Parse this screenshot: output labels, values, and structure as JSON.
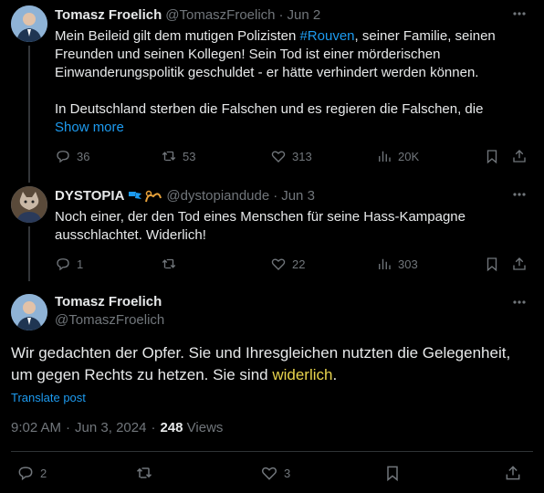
{
  "tweet1": {
    "author_name": "Tomasz Froelich",
    "handle": "@TomaszFroelich",
    "separator": "·",
    "date": "Jun 2",
    "text_part1": "Mein Beileid gilt dem mutigen Polizisten ",
    "hashtag": "#Rouven",
    "text_part2": ", seiner Familie, seinen",
    "text_line2": "Freunden und seinen Kollegen! Sein Tod ist einer mörderischen",
    "text_line3": "Einwanderungspolitik geschuldet - er hätte verhindert werden können.",
    "text_line4": "In Deutschland sterben die Falschen und es regieren die Falschen, die",
    "show_more": "Show more",
    "replies": "36",
    "reposts": "53",
    "likes": "313",
    "views": "20K"
  },
  "tweet2": {
    "author_name": "DYSTOPIA",
    "handle": "@dystopiandude",
    "separator": "·",
    "date": "Jun 3",
    "text_line1": "Noch einer, der den Tod eines Menschen für seine Hass-Kampagne",
    "text_line2": "ausschlachtet. Widerlich!",
    "replies": "1",
    "reposts": "",
    "likes": "22",
    "views": "303"
  },
  "main_tweet": {
    "author_name": "Tomasz Froelich",
    "handle": "@TomaszFroelich",
    "text_line1": "Wir gedachten der Opfer. Sie und Ihresgleichen nutzten die Gelegenheit,",
    "text_line2_pre": "um gegen Rechts zu hetzen. Sie sind ",
    "text_highlight": "widerlich",
    "text_line2_post": ".",
    "translate": "Translate post",
    "time": "9:02 AM",
    "separator": "·",
    "date": "Jun 3, 2024",
    "separator2": "·",
    "views_count": "248",
    "views_label": "Views",
    "replies": "2",
    "reposts": "",
    "likes": "3"
  },
  "colors": {
    "accent": "#1d9bf0",
    "highlight": "#e8d44d",
    "muted": "#71767b"
  },
  "icons": [
    "more-icon",
    "reply-icon",
    "repost-icon",
    "like-icon",
    "views-icon",
    "bookmark-icon",
    "share-icon",
    "verified-flag-icon"
  ]
}
